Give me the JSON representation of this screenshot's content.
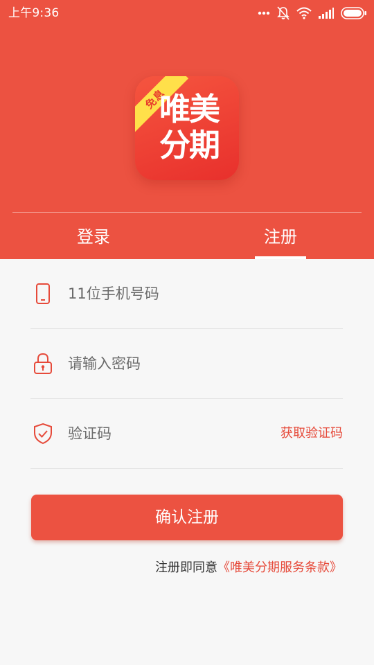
{
  "colors": {
    "brand": "#ec5241",
    "accent_text": "#e64a3a",
    "background": "#f7f7f7",
    "ribbon": "#ffe04a"
  },
  "status_bar": {
    "time": "上午9:36",
    "icons": [
      "dots-icon",
      "mute-bell-icon",
      "wifi-icon",
      "signal-icon",
      "battery-icon"
    ]
  },
  "logo": {
    "ribbon_text": "免息",
    "line1": "唯美",
    "line2": "分期"
  },
  "tabs": [
    {
      "label": "登录",
      "active": false
    },
    {
      "label": "注册",
      "active": true
    }
  ],
  "form": {
    "phone": {
      "placeholder": "11位手机号码",
      "icon": "phone-icon"
    },
    "password": {
      "placeholder": "请输入密码",
      "icon": "lock-icon"
    },
    "code": {
      "placeholder": "验证码",
      "icon": "shield-check-icon",
      "action_label": "获取验证码"
    }
  },
  "submit_label": "确认注册",
  "terms": {
    "prefix": "注册即同意",
    "link": "《唯美分期服务条款》"
  }
}
